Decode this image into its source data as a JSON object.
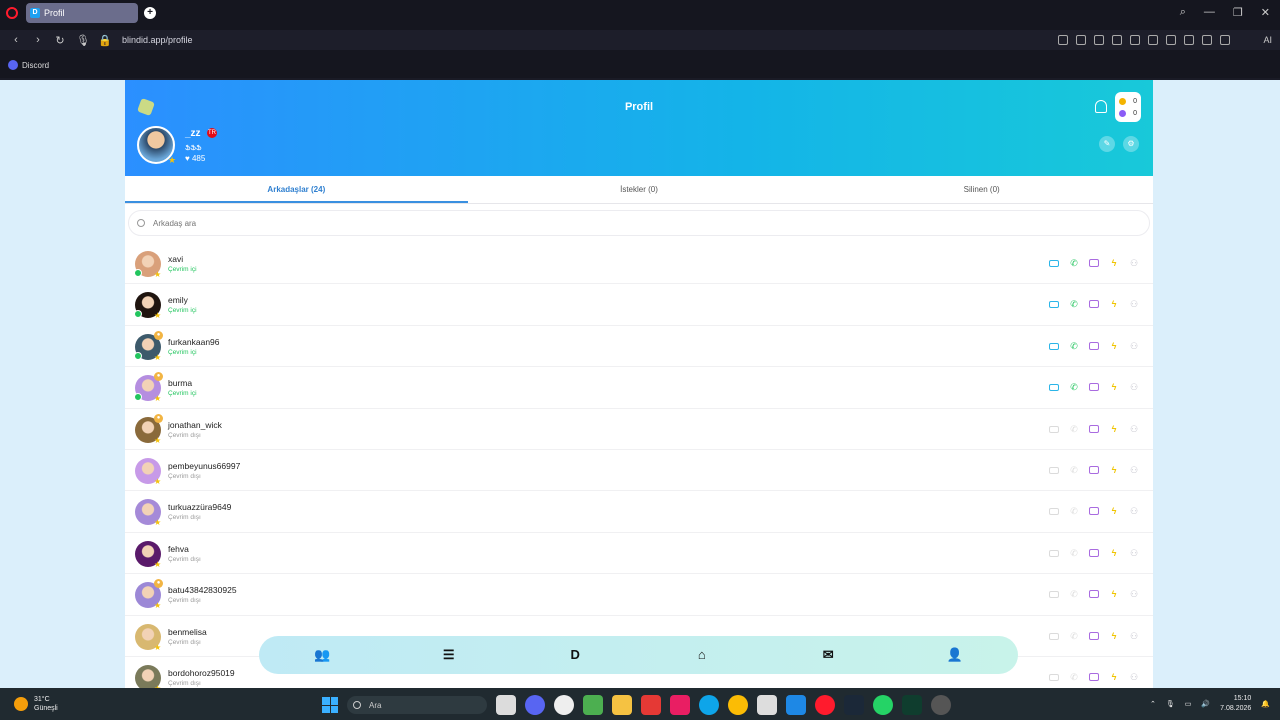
{
  "browser": {
    "tab_title": "Profil",
    "tab_favicon": "D",
    "url": "blindid.app/profile",
    "bookmark": "Discord",
    "ai_label": "AI"
  },
  "header": {
    "title": "Profil",
    "coins_gold": "0",
    "coins_purple": "0",
    "username": "_zz",
    "flag_label": "TR",
    "subtext": "ՖՖՖ",
    "likes": "♥ 485"
  },
  "tabs": [
    {
      "label": "Arkadaşlar (24)"
    },
    {
      "label": "İstekler (0)"
    },
    {
      "label": "Silinen (0)"
    }
  ],
  "search": {
    "placeholder": "Arkadaş ara"
  },
  "friends": [
    {
      "name": "xavi",
      "status": "Çevrim içi",
      "online": true,
      "badge": false
    },
    {
      "name": "emily",
      "status": "Çevrim içi",
      "online": true,
      "badge": false
    },
    {
      "name": "furkankaan96",
      "status": "Çevrim içi",
      "online": true,
      "badge": true
    },
    {
      "name": "burma",
      "status": "Çevrim içi",
      "online": true,
      "badge": true
    },
    {
      "name": "jonathan_wick",
      "status": "Çevrim dışı",
      "online": false,
      "badge": true
    },
    {
      "name": "pembeyunus66997",
      "status": "Çevrim dışı",
      "online": false,
      "badge": false
    },
    {
      "name": "turkuazzüra9649",
      "status": "Çevrim dışı",
      "online": false,
      "badge": false
    },
    {
      "name": "fehva",
      "status": "Çevrim dışı",
      "online": false,
      "badge": false
    },
    {
      "name": "batu43842830925",
      "status": "Çevrim dışı",
      "online": false,
      "badge": true
    },
    {
      "name": "benmelisa",
      "status": "Çevrim dışı",
      "online": false,
      "badge": false
    },
    {
      "name": "bordohoroz95019",
      "status": "Çevrim dışı",
      "online": false,
      "badge": false
    }
  ],
  "taskbar": {
    "temp": "31°C",
    "weather": "Güneşli",
    "search_label": "Ara",
    "time": "15:10",
    "date": "7.08.2026"
  },
  "colors": {
    "accent": "#3a90e0",
    "online": "#22c55e",
    "video": "#2bb5e8",
    "call": "#22c55e",
    "message": "#a96be0",
    "zap": "#f0c400"
  }
}
